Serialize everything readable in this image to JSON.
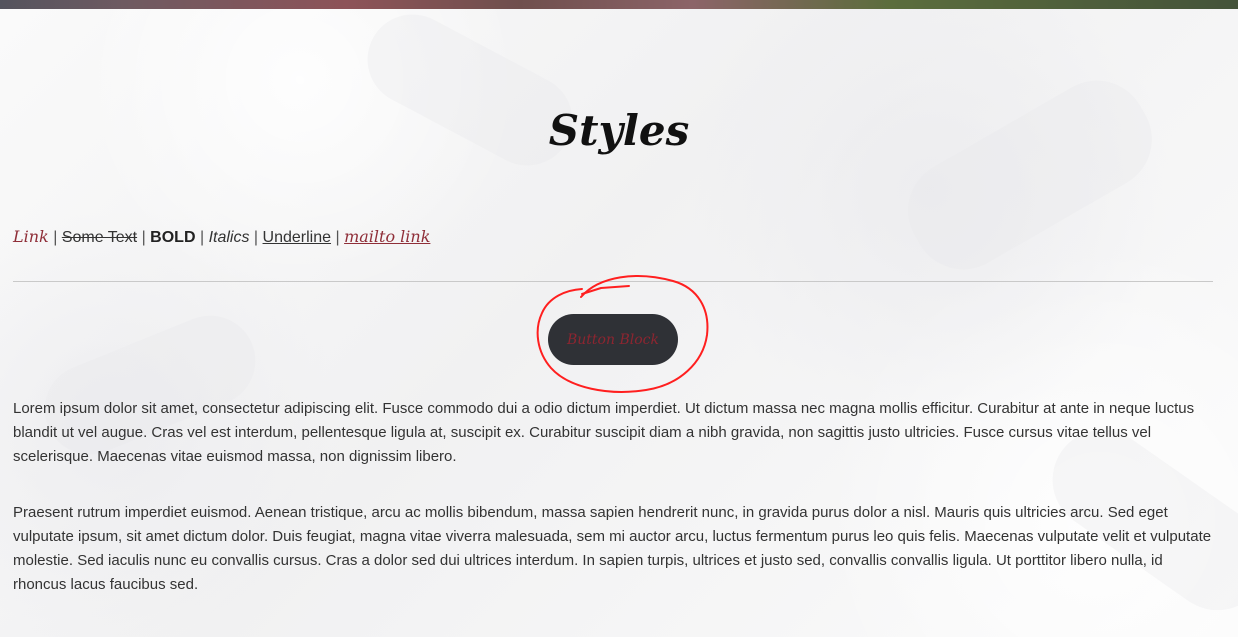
{
  "title": "Styles",
  "styles_row": {
    "link": "Link",
    "separator": "|",
    "strike": "Some Text",
    "bold": "BOLD",
    "italics": "Italics",
    "underline": "Underline",
    "mailto": "mailto link"
  },
  "button": {
    "label": "Button Block"
  },
  "paragraphs": [
    "Lorem ipsum dolor sit amet, consectetur adipiscing elit. Fusce commodo dui a odio dictum imperdiet. Ut dictum massa nec magna mollis efficitur. Curabitur at ante in neque luctus blandit ut vel augue. Cras vel est interdum, pellentesque ligula at, suscipit ex. Curabitur suscipit diam a nibh gravida, non sagittis justo ultricies. Fusce cursus vitae tellus vel scelerisque. Maecenas vitae euismod massa, non dignissim libero.",
    "Praesent rutrum imperdiet euismod. Aenean tristique, arcu ac mollis bibendum, massa sapien hendrerit nunc, in gravida purus dolor a nisl. Mauris quis ultricies arcu. Sed eget vulputate ipsum, sit amet dictum dolor. Duis feugiat, magna vitae viverra malesuada, sem mi auctor arcu, luctus fermentum purus leo quis felis. Maecenas vulputate velit et vulputate molestie. Sed iaculis nunc eu convallis cursus. Cras a dolor sed dui ultrices interdum. In sapien turpis, ultrices et justo sed, convallis convallis ligula. Ut porttitor libero nulla, id rhoncus lacus faucibus sed."
  ],
  "colors": {
    "accent": "#8f2e38",
    "button_background": "#2f3136",
    "annotation": "#ff1f1f"
  }
}
